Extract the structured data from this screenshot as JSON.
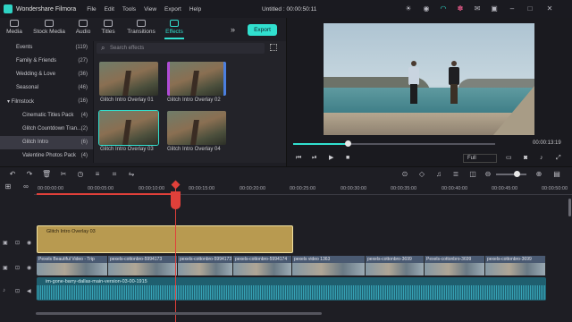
{
  "titlebar": {
    "app_name": "Wondershare Filmora",
    "menu": [
      "File",
      "Edit",
      "Tools",
      "View",
      "Export",
      "Help"
    ],
    "doc_title": "Untitled : 00:00:50:11",
    "icons": [
      "sun-icon",
      "account-icon",
      "headset-icon",
      "gift-icon",
      "mail-icon",
      "save-icon",
      "minimize-icon",
      "maximize-icon",
      "close-icon"
    ]
  },
  "tabs": [
    {
      "label": "Media",
      "icon": "media-icon"
    },
    {
      "label": "Stock Media",
      "icon": "stock-media-icon"
    },
    {
      "label": "Audio",
      "icon": "audio-icon"
    },
    {
      "label": "Titles",
      "icon": "titles-icon"
    },
    {
      "label": "Transitions",
      "icon": "transitions-icon"
    },
    {
      "label": "Effects",
      "icon": "effects-icon",
      "active": true
    }
  ],
  "export_label": "Export",
  "categories": [
    {
      "label": "Events",
      "count": "(119)"
    },
    {
      "label": "Family & Friends",
      "count": "(27)"
    },
    {
      "label": "Wedding & Love",
      "count": "(36)"
    },
    {
      "label": "Seasonal",
      "count": "(46)"
    },
    {
      "label": "Filmstock",
      "count": "(16)",
      "expanded": true
    },
    {
      "label": "Cinematic Titles Pack",
      "count": "(4)"
    },
    {
      "label": "Glitch Countdown Tran...",
      "count": "(2)"
    },
    {
      "label": "Glitch Intro",
      "count": "(6)",
      "selected": true
    },
    {
      "label": "Valentine Photos Pack",
      "count": "(4)"
    }
  ],
  "search": {
    "placeholder": "Search effects"
  },
  "effects": [
    {
      "label": "Glitch Intro Overlay 01"
    },
    {
      "label": "Glitch Intro Overlay 02"
    },
    {
      "label": "Glitch Intro Overlay 03",
      "selected": true
    },
    {
      "label": "Glitch Intro Overlay 04"
    }
  ],
  "preview": {
    "timecode": "00:00:13:19",
    "quality": "Full",
    "progress": 0.27
  },
  "ruler": {
    "labels": [
      "00:00:00:00",
      "00:00:05:00",
      "00:00:10:00",
      "00:00:15:00",
      "00:00:20:00",
      "00:00:25:00",
      "00:00:30:00",
      "00:00:35:00",
      "00:00:40:00",
      "00:00:45:00",
      "00:00:50:00"
    ]
  },
  "timeline": {
    "effect_clip": "Glitch Intro Overlay 03",
    "video_clips": [
      "Pexels Beautiful Video - Trip",
      "pexels-cottonbro-5994173",
      "pexels-cottonbro-5994173",
      "pexels-cottonbro-5994174",
      "pexels video 1363",
      "pexels-cottonbro-3699",
      "Pexels-cottonbro-3699",
      "pexels-cottonbro-3699"
    ],
    "audio_clip": "im-gone-barry-dallas-main-version-03-00-1915"
  },
  "colors": {
    "accent": "#31e0cf",
    "playhead": "#e0403a",
    "effect_clip": "#b89a50",
    "audio_clip": "#1f5f6f"
  }
}
